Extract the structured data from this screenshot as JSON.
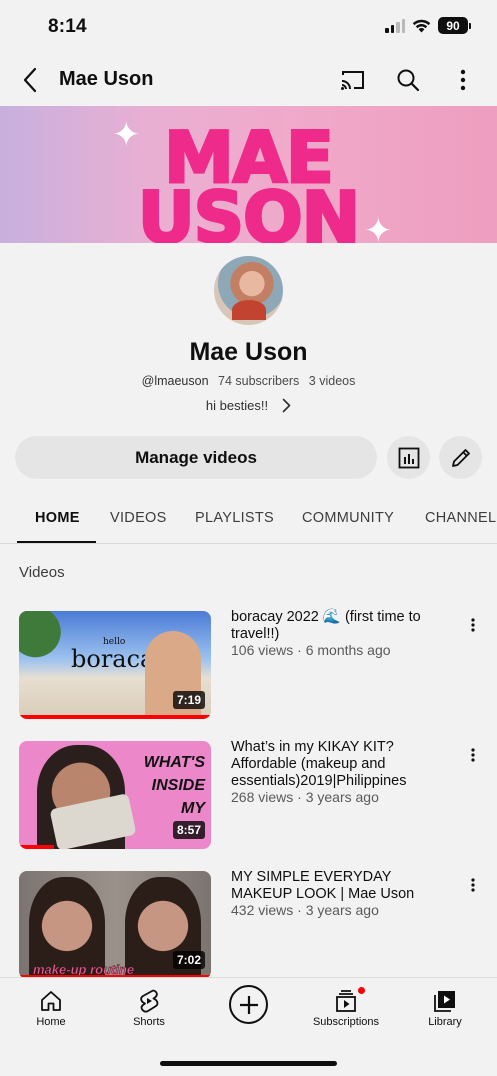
{
  "status": {
    "time": "8:14",
    "battery": "90"
  },
  "header": {
    "title": "Mae Uson"
  },
  "banner": {
    "line1": "MAE",
    "line2": "USON"
  },
  "channel": {
    "name": "Mae Uson",
    "handle": "@lmaeuson",
    "subscribers": "74 subscribers",
    "videos": "3 videos",
    "description": "hi besties!!",
    "manage_label": "Manage videos"
  },
  "tabs": [
    "HOME",
    "VIDEOS",
    "PLAYLISTS",
    "COMMUNITY",
    "CHANNELS"
  ],
  "section_title": "Videos",
  "videos": [
    {
      "title": "boracay 2022 🌊 (first time to travel!!)",
      "meta": "106 views · 6 months ago",
      "duration": "7:19",
      "thumb_text": "boracay",
      "thumb_small": "hello",
      "progress": 1.0
    },
    {
      "title": "What’s in my KIKAY KIT? Affordable (makeup and essentials)2019|Philippines",
      "meta": "268 views · 3 years ago",
      "duration": "8:57",
      "thumb_lines": [
        "WHAT'S",
        "INSIDE",
        "MY"
      ],
      "progress": 0.18
    },
    {
      "title": "MY SIMPLE EVERYDAY MAKEUP LOOK | Mae Uson",
      "meta": "432 views · 3 years ago",
      "duration": "7:02",
      "thumb_text": "make-up routine",
      "progress": 1.0
    }
  ],
  "nav": {
    "home": "Home",
    "shorts": "Shorts",
    "subscriptions": "Subscriptions",
    "library": "Library"
  }
}
